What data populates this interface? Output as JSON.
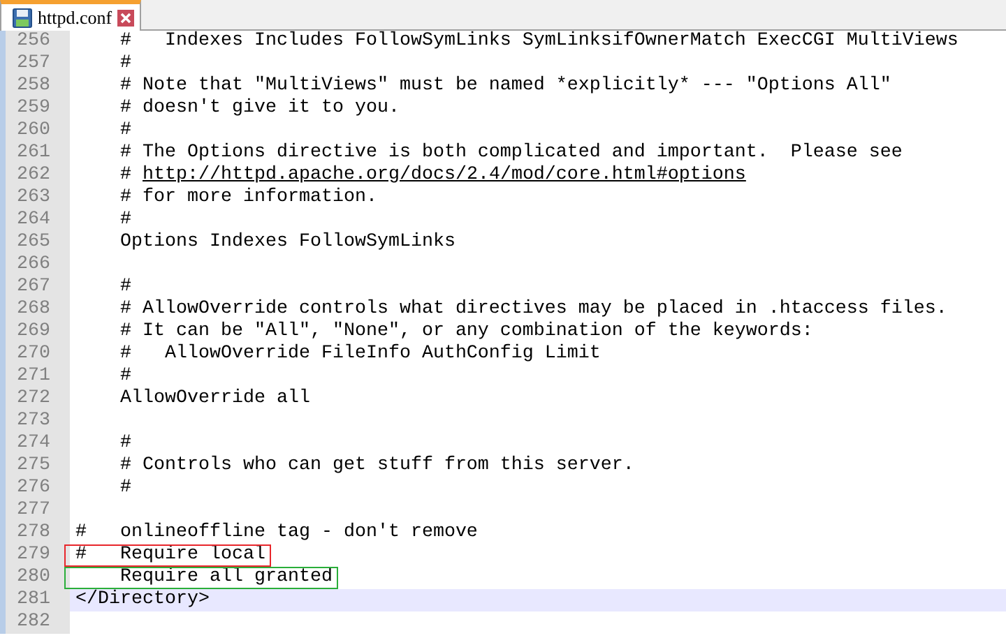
{
  "tabs": [
    {
      "label": "httpd.conf",
      "selected": true
    }
  ],
  "lines": [
    {
      "num": "256",
      "text": "    #   Indexes Includes FollowSymLinks SymLinksifOwnerMatch ExecCGI MultiViews"
    },
    {
      "num": "257",
      "text": "    #"
    },
    {
      "num": "258",
      "text": "    # Note that \"MultiViews\" must be named *explicitly* --- \"Options All\""
    },
    {
      "num": "259",
      "text": "    # doesn't give it to you."
    },
    {
      "num": "260",
      "text": "    #"
    },
    {
      "num": "261",
      "text": "    # The Options directive is both complicated and important.  Please see"
    },
    {
      "num": "262",
      "text": "    # ",
      "link": "http://httpd.apache.org/docs/2.4/mod/core.html#options"
    },
    {
      "num": "263",
      "text": "    # for more information."
    },
    {
      "num": "264",
      "text": "    #"
    },
    {
      "num": "265",
      "text": "    Options Indexes FollowSymLinks"
    },
    {
      "num": "266"
    },
    {
      "num": "267",
      "text": "    #"
    },
    {
      "num": "268",
      "text": "    # AllowOverride controls what directives may be placed in .htaccess files."
    },
    {
      "num": "269",
      "text": "    # It can be \"All\", \"None\", or any combination of the keywords:"
    },
    {
      "num": "270",
      "text": "    #   AllowOverride FileInfo AuthConfig Limit"
    },
    {
      "num": "271",
      "text": "    #"
    },
    {
      "num": "272",
      "text": "    AllowOverride all"
    },
    {
      "num": "273"
    },
    {
      "num": "274",
      "text": "    #"
    },
    {
      "num": "275",
      "text": "    # Controls who can get stuff from this server."
    },
    {
      "num": "276",
      "text": "    #"
    },
    {
      "num": "277"
    },
    {
      "num": "278",
      "text": "#   onlineoffline tag - don't remove"
    },
    {
      "num": "279",
      "text": "#   Require local",
      "color": "#e8262b"
    },
    {
      "num": "280",
      "text": "    Require all granted",
      "color": "#2aae3a"
    },
    {
      "num": "281",
      "text": "</Directory>",
      "current": true
    },
    {
      "num": "282"
    }
  ]
}
